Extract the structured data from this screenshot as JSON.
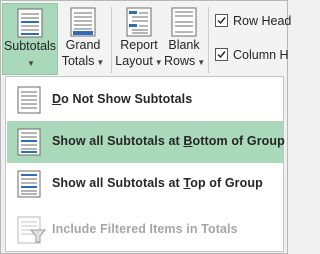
{
  "ribbon": {
    "subtotals": {
      "line1": "Subtotals",
      "line2": ""
    },
    "grand_totals": {
      "line1": "Grand",
      "line2": "Totals"
    },
    "report_layout": {
      "line1": "Report",
      "line2": "Layout"
    },
    "blank_rows": {
      "line1": "Blank",
      "line2": "Rows"
    },
    "row_headers": {
      "label": "Row Head",
      "checked": true
    },
    "column_headers": {
      "label": "Column H",
      "checked": true
    }
  },
  "menu": {
    "items": [
      {
        "pre": "",
        "key": "D",
        "post": "o Not Show Subtotals",
        "state": "normal"
      },
      {
        "pre": "Show all Subtotals at ",
        "key": "B",
        "post": "ottom of Group",
        "state": "hover"
      },
      {
        "pre": "Show all Subtotals at ",
        "key": "T",
        "post": "op of Group",
        "state": "normal"
      },
      {
        "pre": "Include Filtered Items in Totals",
        "key": "",
        "post": "",
        "state": "disabled"
      }
    ]
  },
  "colors": {
    "highlight": "#a9d8bb",
    "icon_blue": "#2e6db4",
    "disabled": "#a6a6a6"
  }
}
